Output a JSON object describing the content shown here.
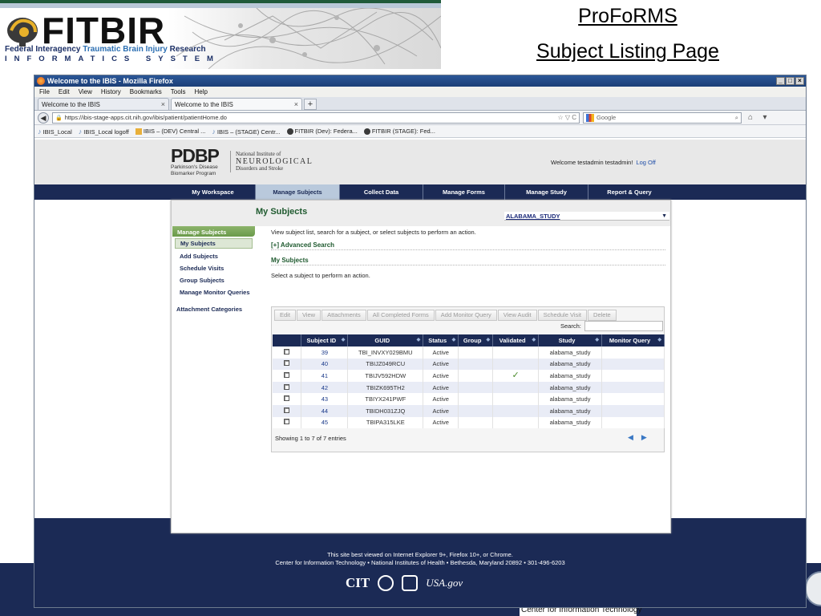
{
  "slide": {
    "logo_text": "FITBIR",
    "logo_subtitle_a": "Federal Interagency",
    "logo_subtitle_b": "Traumatic Brain Injury",
    "logo_subtitle_c": "Research",
    "logo_tagline": "INFORMATICS SYSTEM",
    "title_line1": "ProFoRMS",
    "title_line2": "Subject Listing Page",
    "footer_text": "Center for Information Technology"
  },
  "browser": {
    "window_title": "Welcome to the IBIS - Mozilla Firefox",
    "window_buttons": [
      "_",
      "□",
      "×"
    ],
    "menu": [
      "File",
      "Edit",
      "View",
      "History",
      "Bookmarks",
      "Tools",
      "Help"
    ],
    "tabs": [
      {
        "label": "Welcome to the IBIS",
        "close": "×"
      },
      {
        "label": "Welcome to the IBIS",
        "close": "×"
      }
    ],
    "new_tab": "+",
    "url": "https://ibis-stage-apps.cit.nih.gov/ibis/patient/patientHome.do",
    "url_actions": "☆ ▽ C",
    "search_placeholder": "Google",
    "bookmarks": [
      "IBIS_Local",
      "IBIS_Local logoff",
      "IBIS – (DEV) Central ...",
      "IBIS – (STAGE) Centr...",
      "FITBIR (Dev): Federa...",
      "FITBIR (STAGE): Fed..."
    ]
  },
  "page": {
    "pdbp_logo": "PDBP",
    "pdbp_sub": "Parkinson's Disease Biomarker Program",
    "ninds_line1": "National Institute of",
    "ninds_line2": "NEUROLOGICAL",
    "ninds_line3": "Disorders and Stroke",
    "welcome": "Welcome testadmin testadmin!",
    "logoff": "Log Off",
    "nav": [
      "My Workspace",
      "Manage Subjects",
      "Collect Data",
      "Manage Forms",
      "Manage Study",
      "Report & Query"
    ],
    "content_title": "My Subjects",
    "study_select": "ALABAMA_STUDY",
    "leftnav": {
      "header": "Manage Subjects",
      "items": [
        "My Subjects",
        "Add Subjects",
        "Schedule Visits",
        "Group Subjects",
        "Manage Monitor Queries"
      ],
      "attachments": "Attachment Categories"
    },
    "intro": "View subject list, search for a subject, or select subjects to perform an action.",
    "advanced_search": "[+] Advanced Search",
    "my_subjects_heading": "My Subjects",
    "select_text": "Select a subject to perform an action.",
    "toolbar": [
      "Edit",
      "View",
      "Attachments",
      "All Completed Forms",
      "Add Monitor Query",
      "View Audit",
      "Schedule Visit",
      "Delete"
    ],
    "search_label": "Search:",
    "search_value": "",
    "columns": [
      "",
      "Subject ID",
      "GUID",
      "Status",
      "Group",
      "Validated",
      "Study",
      "Monitor Query"
    ],
    "rows": [
      {
        "id": "39",
        "guid": "TBI_INVXY029BMU",
        "status": "Active",
        "group": "",
        "validated": false,
        "study": "alabama_study",
        "mq": ""
      },
      {
        "id": "40",
        "guid": "TBIJZ049RCU",
        "status": "Active",
        "group": "",
        "validated": false,
        "study": "alabama_study",
        "mq": ""
      },
      {
        "id": "41",
        "guid": "TBIJV592HDW",
        "status": "Active",
        "group": "",
        "validated": true,
        "study": "alabama_study",
        "mq": ""
      },
      {
        "id": "42",
        "guid": "TBIZK695TH2",
        "status": "Active",
        "group": "",
        "validated": false,
        "study": "alabama_study",
        "mq": ""
      },
      {
        "id": "43",
        "guid": "TBIYX241PWF",
        "status": "Active",
        "group": "",
        "validated": false,
        "study": "alabama_study",
        "mq": ""
      },
      {
        "id": "44",
        "guid": "TBIDH031ZJQ",
        "status": "Active",
        "group": "",
        "validated": false,
        "study": "alabama_study",
        "mq": ""
      },
      {
        "id": "45",
        "guid": "TBIPA315LKE",
        "status": "Active",
        "group": "",
        "validated": false,
        "study": "alabama_study",
        "mq": ""
      }
    ],
    "showing": "Showing 1 to 7 of 7 entries",
    "footer_line1": "This site best viewed on Internet Explorer 9+, Firefox 10+, or Chrome.",
    "footer_line2": "Center for Information Technology • National Institutes of Health • Bethesda, Maryland 20892 • 301-496-6203",
    "footer_logo_cit": "CIT",
    "footer_logo_usa": "USA.gov"
  },
  "colors": {
    "nav_bg": "#1b2a55",
    "accent_green": "#1f5a2f",
    "nav_active": "#b9c9dc"
  }
}
